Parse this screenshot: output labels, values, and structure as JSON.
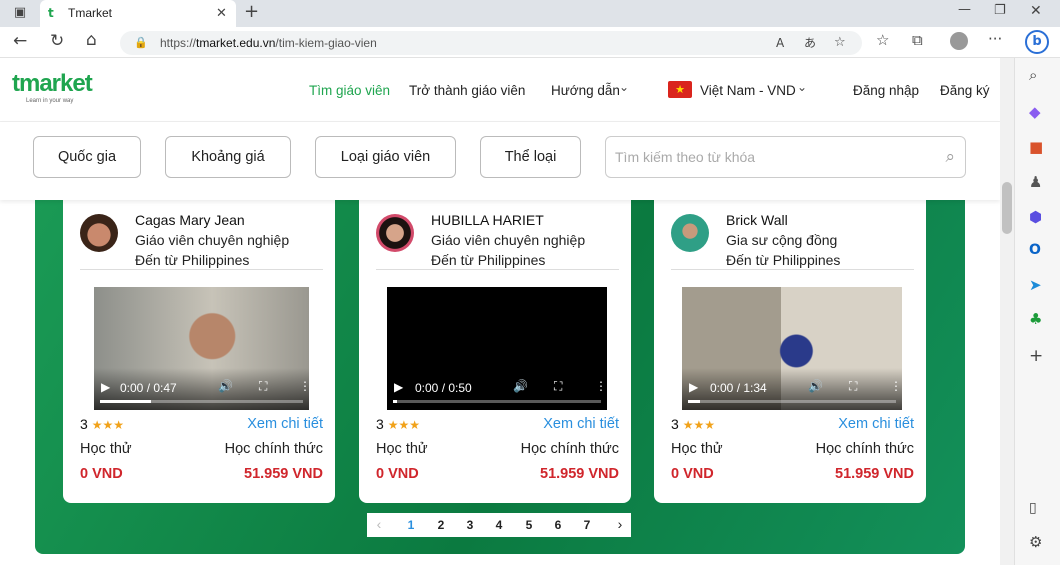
{
  "browser": {
    "tab_title": "Tmarket",
    "url_prefix": "https://",
    "url_domain": "tmarket.edu.vn",
    "url_path": "/tim-kiem-giao-vien"
  },
  "nav": {
    "logo_text": "tmarket",
    "logo_tagline": "Learn in your way",
    "links": [
      "Tìm giáo viên",
      "Trở thành giáo viên",
      "Hướng dẫn",
      "Việt Nam - VND",
      "Đăng nhập",
      "Đăng ký"
    ]
  },
  "filters": {
    "buttons": [
      "Quốc gia",
      "Khoảng giá",
      "Loại giáo viên",
      "Thể loại"
    ],
    "search_placeholder": "Tìm kiếm theo từ khóa"
  },
  "colors": {
    "accent": "#1fa54f",
    "price": "#d0262c",
    "link": "#2a8fde",
    "star": "#f1a21a"
  },
  "teachers": [
    {
      "name": "Cagas Mary Jean",
      "role": "Giáo viên chuyên nghiệp",
      "origin": "Đến từ Philippines",
      "time": "0:00 / 0:47",
      "progress": 0.25,
      "rating": "3",
      "more": "Xem chi tiết",
      "trial_label": "Học thử",
      "official_label": "Học chính thức",
      "trial_price": "0 VND",
      "official_price": "51.959 VND"
    },
    {
      "name": "HUBILLA HARIET",
      "role": "Giáo viên chuyên nghiệp",
      "origin": "Đến từ Philippines",
      "time": "0:00 / 0:50",
      "progress": 0.02,
      "rating": "3",
      "more": "Xem chi tiết",
      "trial_label": "Học thử",
      "official_label": "Học chính thức",
      "trial_price": "0 VND",
      "official_price": "51.959 VND"
    },
    {
      "name": "Brick Wall",
      "role": "Gia sư cộng đồng",
      "origin": "Đến từ Philippines",
      "time": "0:00 / 1:34",
      "progress": 0.06,
      "rating": "3",
      "more": "Xem chi tiết",
      "trial_label": "Học thử",
      "official_label": "Học chính thức",
      "trial_price": "0 VND",
      "official_price": "51.959 VND"
    }
  ],
  "pagination": {
    "prev": "‹",
    "next": "›",
    "pages": [
      "1",
      "2",
      "3",
      "4",
      "5",
      "6",
      "7"
    ],
    "current": "1"
  }
}
